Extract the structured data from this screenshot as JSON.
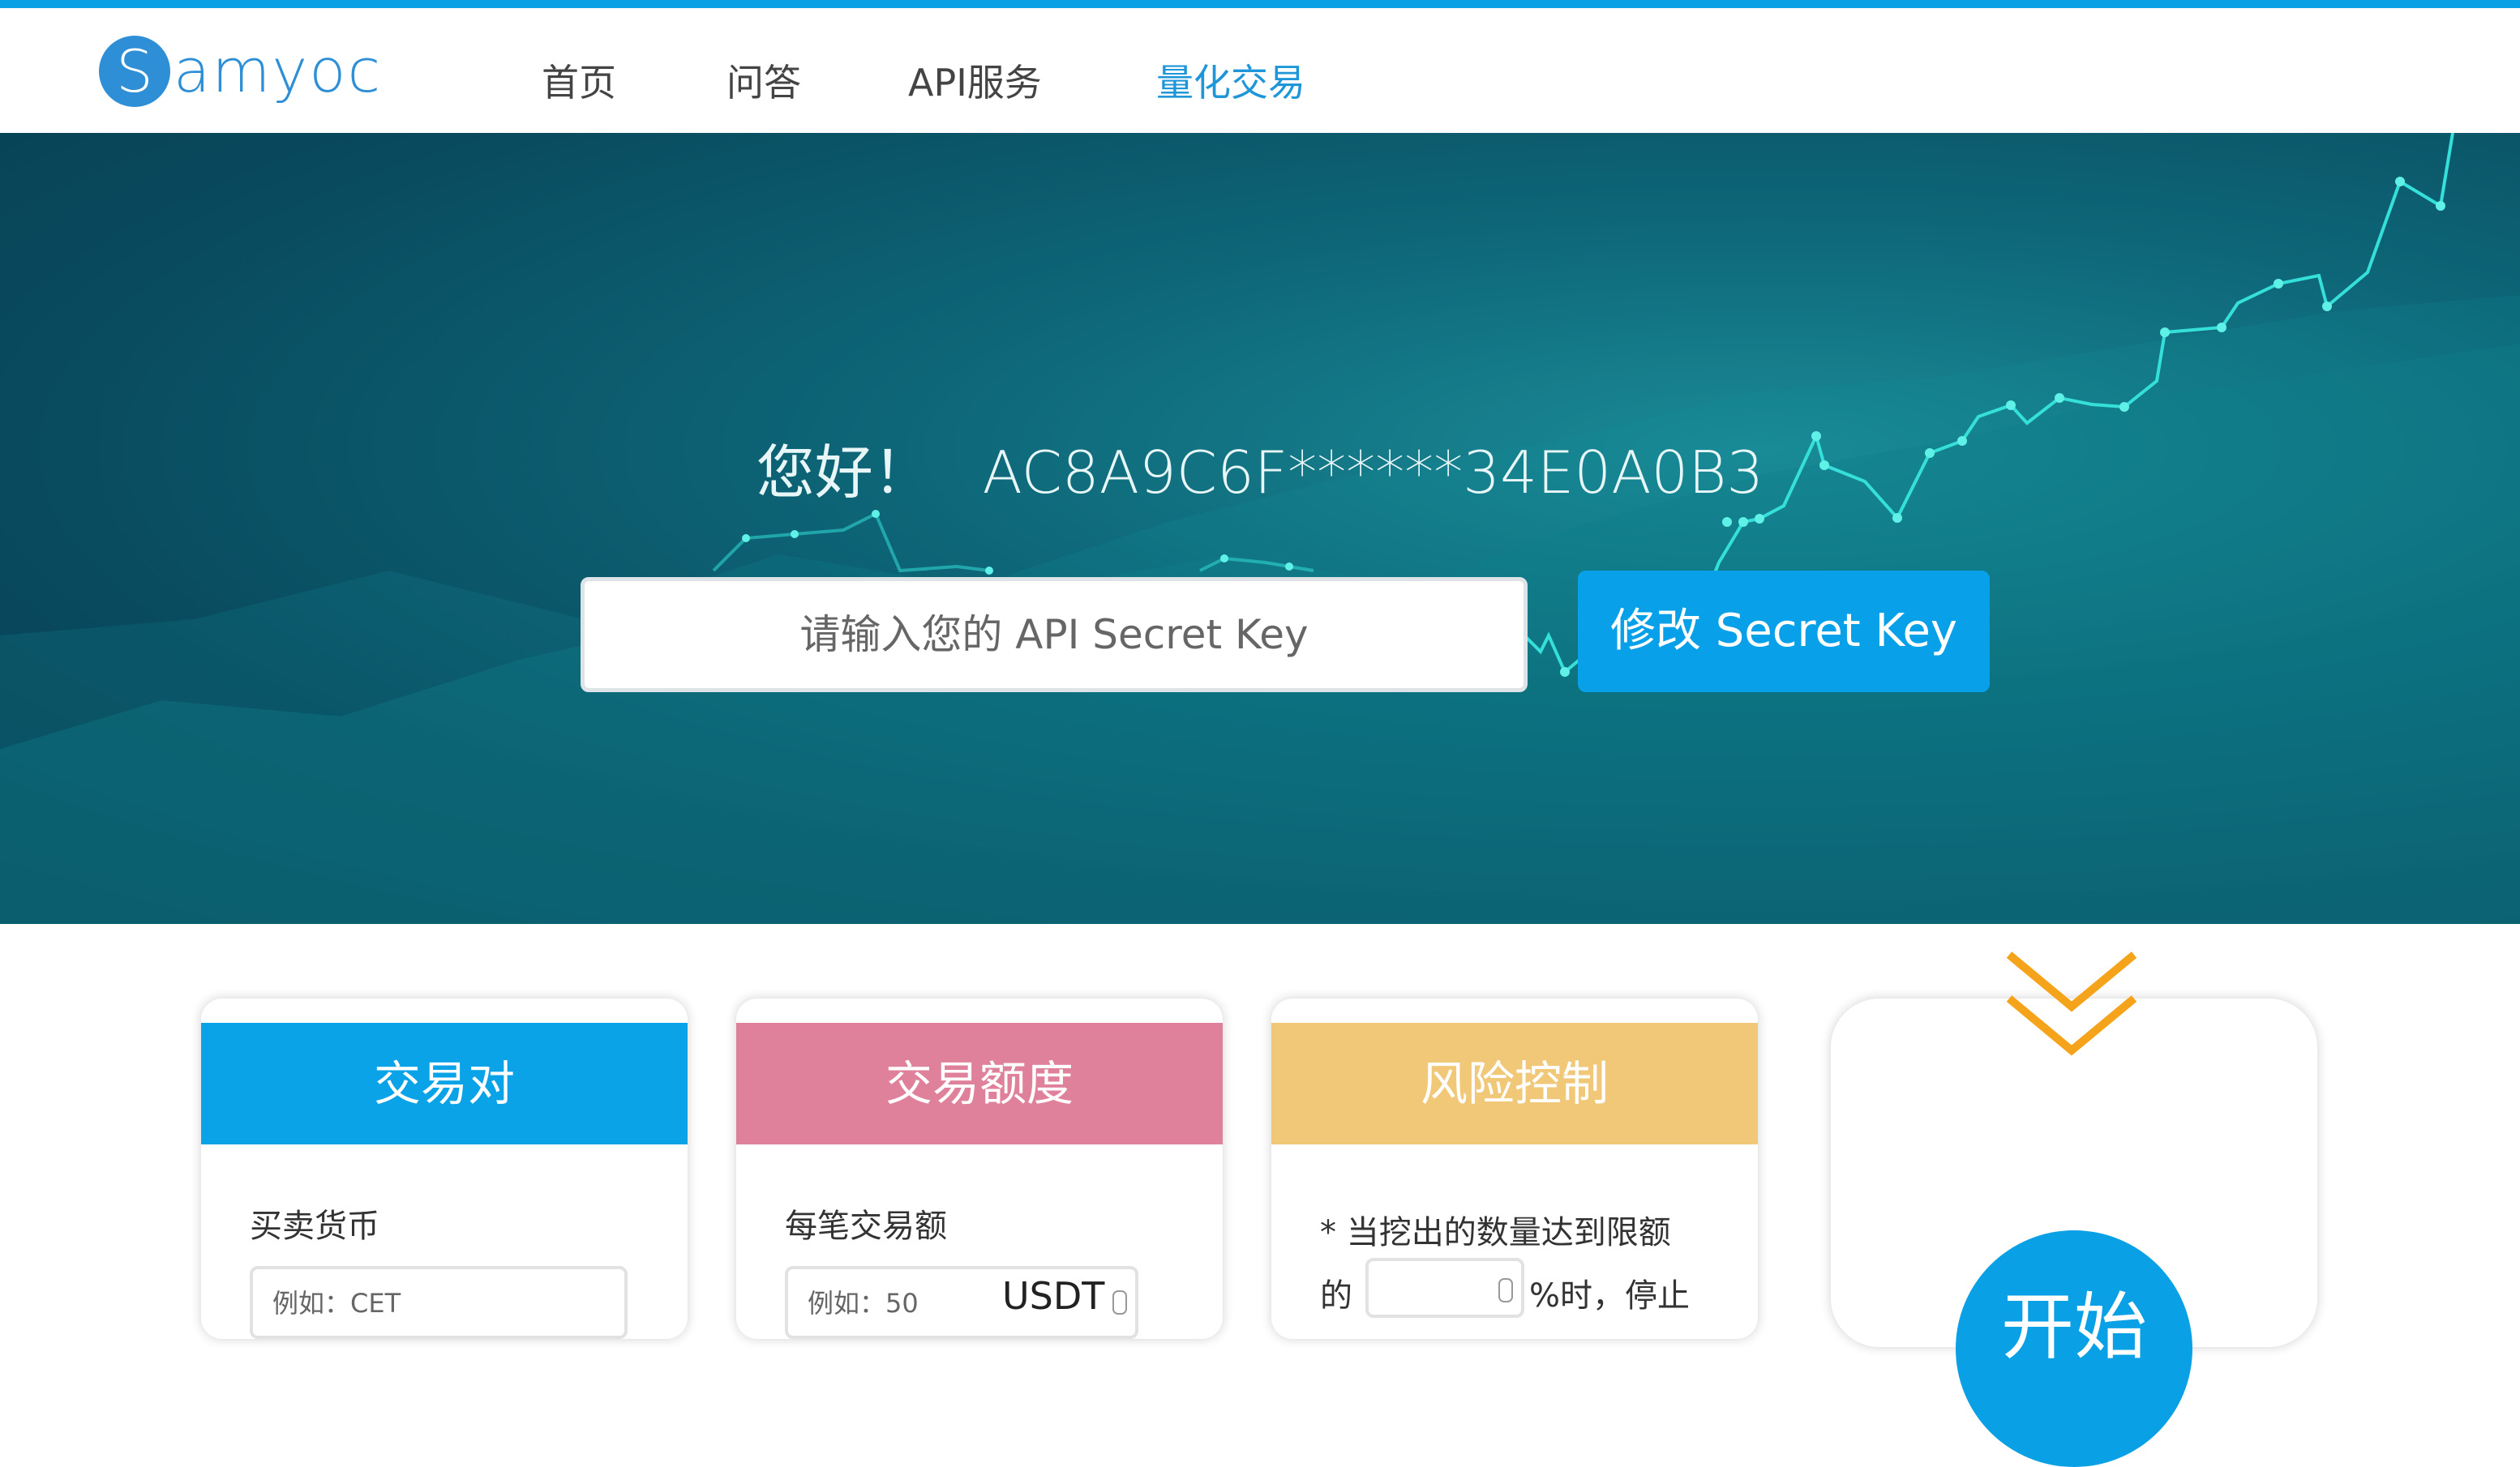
{
  "brand": {
    "logo_letter": "S",
    "logo_text": "amyoc",
    "color": "#2f8fd6"
  },
  "nav": {
    "items": [
      {
        "label": "首页",
        "active": false
      },
      {
        "label": "问答",
        "active": false
      },
      {
        "label": "API服务",
        "active": false
      },
      {
        "label": "量化交易",
        "active": true
      }
    ]
  },
  "hero": {
    "greeting": "您好！",
    "api_key_masked": "AC8A9C6F******34E0A0B3",
    "secret_input": {
      "placeholder": "请输入您的 API Secret Key",
      "value": ""
    },
    "modify_button_label": "修改 Secret Key"
  },
  "cards": [
    {
      "title": "交易对",
      "color": "#0aa3e8",
      "label": "买卖货币",
      "field_placeholder": "例如：CET"
    },
    {
      "title": "交易额度",
      "color": "#e0819b",
      "label": "每笔交易额",
      "field_placeholder": "例如：50",
      "unit": "USDT"
    },
    {
      "title": "风险控制",
      "color": "#f0c878",
      "label": "* 当挖出的数量达到限额",
      "label2_prefix": "的",
      "label2_suffix": "%时，停止"
    }
  ],
  "start": {
    "label": "开始",
    "accent": "#f5a31a"
  },
  "colors": {
    "accent": "#0aa0e6"
  }
}
